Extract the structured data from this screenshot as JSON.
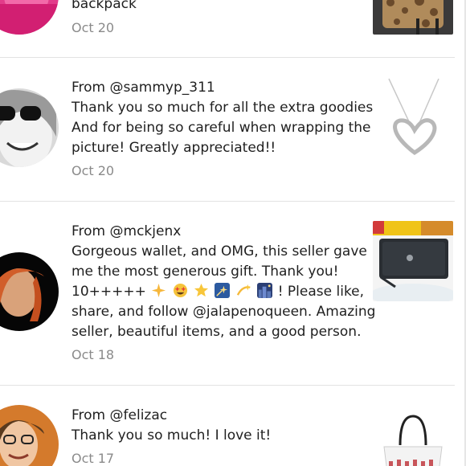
{
  "reviews": [
    {
      "from": "",
      "message_lines": [
        "backpack"
      ],
      "date": "Oct 20"
    },
    {
      "from": "From @sammyp_311",
      "message_lines": [
        "Thank you so much for all the extra goodies!!",
        "And for being so careful when wrapping the",
        "picture! Greatly appreciated!!"
      ],
      "date": "Oct 20"
    },
    {
      "from": "From @mckjenx",
      "message_lines": [
        "Gorgeous wallet, and OMG, this seller gave",
        "me the most generous gift. Thank you!",
        "10+++++",
        "! Please like,",
        "share, and follow @jalapenoqueen. Amazing",
        "seller, beautiful items, and a good person."
      ],
      "emojis": [
        "sparkle-star-icon",
        "star-struck-face-icon",
        "star-icon",
        "shooting-star-card-icon",
        "dizzy-icon",
        "night-city-icon"
      ],
      "date": "Oct 18"
    },
    {
      "from": "From @felizac",
      "message_lines": [
        "Thank you so much! I love it!"
      ],
      "date": "Oct 17"
    }
  ],
  "colors": {
    "separator": "#e3e3e3",
    "date": "#8a8a8a",
    "text": "#1f1f1f"
  }
}
